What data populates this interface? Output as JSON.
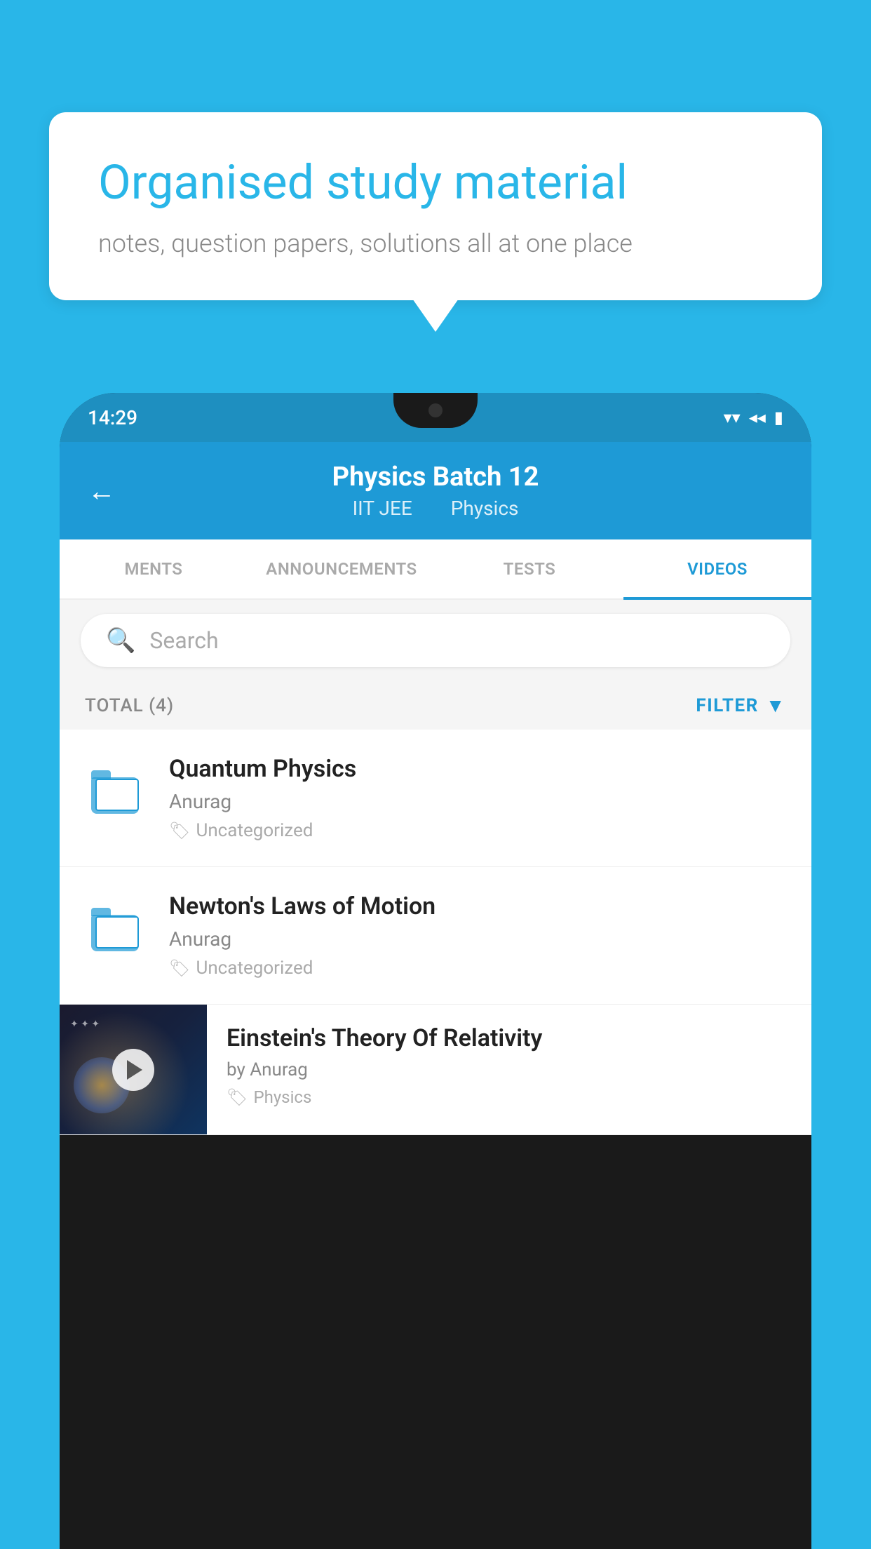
{
  "background_color": "#29b6e8",
  "speech_bubble": {
    "heading": "Organised study material",
    "subtext": "notes, question papers, solutions all at one place"
  },
  "phone": {
    "status_bar": {
      "time": "14:29",
      "icons": [
        "wifi",
        "signal",
        "battery"
      ]
    },
    "app_header": {
      "back_label": "←",
      "title": "Physics Batch 12",
      "subtitle_left": "IIT JEE",
      "subtitle_right": "Physics"
    },
    "tabs": [
      {
        "label": "MENTS",
        "active": false
      },
      {
        "label": "ANNOUNCEMENTS",
        "active": false
      },
      {
        "label": "TESTS",
        "active": false
      },
      {
        "label": "VIDEOS",
        "active": true
      }
    ],
    "search": {
      "placeholder": "Search"
    },
    "total": {
      "label": "TOTAL (4)",
      "filter_label": "FILTER"
    },
    "videos": [
      {
        "title": "Quantum Physics",
        "author": "Anurag",
        "tag": "Uncategorized",
        "type": "folder"
      },
      {
        "title": "Newton's Laws of Motion",
        "author": "Anurag",
        "tag": "Uncategorized",
        "type": "folder"
      },
      {
        "title": "Einstein's Theory Of Relativity",
        "author": "by Anurag",
        "tag": "Physics",
        "type": "video"
      }
    ]
  }
}
